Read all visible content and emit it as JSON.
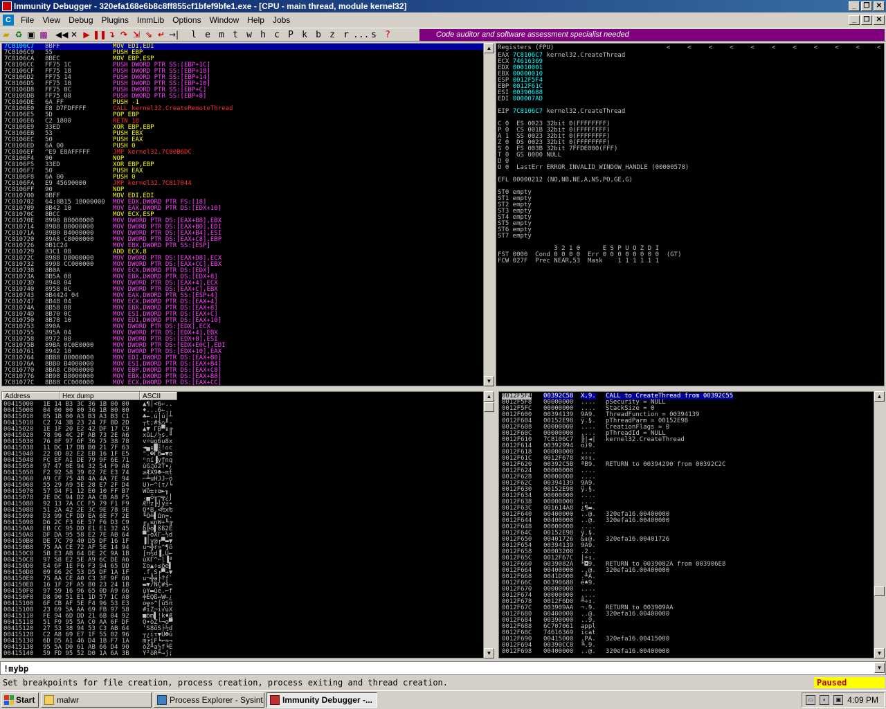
{
  "window": {
    "title": "Immunity Debugger - 320efa168e6b8c8ff855cf1bfef9bfe1.exe - [CPU - main thread, module kernel32]"
  },
  "menu": [
    "File",
    "View",
    "Debug",
    "Plugins",
    "ImmLib",
    "Options",
    "Window",
    "Help",
    "Jobs"
  ],
  "toolbar": {
    "letters": [
      "l",
      "e",
      "m",
      "t",
      "w",
      "h",
      "c",
      "P",
      "k",
      "b",
      "z",
      "r",
      "...",
      "s",
      "?"
    ],
    "banner": "Code auditor and software assessment specialist needed"
  },
  "disasm": [
    [
      "7C8106C7",
      "8BFF",
      "MOV EDI,EDI",
      "y"
    ],
    [
      "7C8106C9",
      "55",
      "PUSH EBP",
      "y"
    ],
    [
      "7C8106CA",
      "8BEC",
      "MOV EBP,ESP",
      "y"
    ],
    [
      "7C8106CC",
      "FF75 1C",
      "PUSH DWORD PTR SS:[EBP+1C]",
      "m"
    ],
    [
      "7C8106CF",
      "FF75 18",
      "PUSH DWORD PTR SS:[EBP+18]",
      "m"
    ],
    [
      "7C8106D2",
      "FF75 14",
      "PUSH DWORD PTR SS:[EBP+14]",
      "m"
    ],
    [
      "7C8106D5",
      "FF75 10",
      "PUSH DWORD PTR SS:[EBP+10]",
      "m"
    ],
    [
      "7C8106D8",
      "FF75 0C",
      "PUSH DWORD PTR SS:[EBP+C]",
      "m"
    ],
    [
      "7C8106DB",
      "FF75 08",
      "PUSH DWORD PTR SS:[EBP+8]",
      "m"
    ],
    [
      "7C8106DE",
      "6A FF",
      "PUSH -1",
      "y"
    ],
    [
      "7C8106E0",
      "E8 D7FDFFFF",
      "CALL kernel32.CreateRemoteThread",
      "r"
    ],
    [
      "7C8106E5",
      "5D",
      "POP EBP",
      "y"
    ],
    [
      "7C8106E6",
      "C2 1800",
      "RETN 18",
      "r"
    ],
    [
      "7C8106E9",
      "33ED",
      "XOR EBP,EBP",
      "y"
    ],
    [
      "7C8106EB",
      "53",
      "PUSH EBX",
      "y"
    ],
    [
      "7C8106EC",
      "50",
      "PUSH EAX",
      "y"
    ],
    [
      "7C8106ED",
      "6A 00",
      "PUSH 0",
      "y"
    ],
    [
      "7C8106EF",
      "^E9 E8AFFFFF",
      "JMP kernel32.7C80B6DC",
      "r"
    ],
    [
      "7C8106F4",
      "90",
      "NOP",
      "y"
    ],
    [
      "7C8106F5",
      "33ED",
      "XOR EBP,EBP",
      "y"
    ],
    [
      "7C8106F7",
      "50",
      "PUSH EAX",
      "y"
    ],
    [
      "7C8106F8",
      "6A 00",
      "PUSH 0",
      "y"
    ],
    [
      "7C8106FA",
      "E9 45690000",
      "JMP kernel32.7C817044",
      "r"
    ],
    [
      "7C8106FF",
      "90",
      "NOP",
      "y"
    ],
    [
      "7C810700",
      "8BFF",
      "MOV EDI,EDI",
      "y"
    ],
    [
      "7C810702",
      "64:8B15 18000000",
      "MOV EDX,DWORD PTR FS:[18]",
      "m"
    ],
    [
      "7C810709",
      "8B42 10",
      "MOV EAX,DWORD PTR DS:[EDX+10]",
      "m"
    ],
    [
      "7C81070C",
      "8BCC",
      "MOV ECX,ESP",
      "y"
    ],
    [
      "7C81070E",
      "8998 B8000000",
      "MOV DWORD PTR DS:[EAX+B8],EBX",
      "m"
    ],
    [
      "7C810714",
      "89B8 B0000000",
      "MOV DWORD PTR DS:[EAX+B0],EDI",
      "m"
    ],
    [
      "7C81071A",
      "89B0 B4000000",
      "MOV DWORD PTR DS:[EAX+B4],ESI",
      "m"
    ],
    [
      "7C810720",
      "89A8 C8000000",
      "MOV DWORD PTR DS:[EAX+C8],EBP",
      "m"
    ],
    [
      "7C810726",
      "8B1C24",
      "MOV EBX,DWORD PTR SS:[ESP]",
      "m"
    ],
    [
      "7C810729",
      "83C1 08",
      "ADD ECX,8",
      "y"
    ],
    [
      "7C81072C",
      "8988 D8000000",
      "MOV DWORD PTR DS:[EAX+D8],ECX",
      "m"
    ],
    [
      "7C810732",
      "8998 CC000000",
      "MOV DWORD PTR DS:[EAX+CC],EBX",
      "m"
    ],
    [
      "7C810738",
      "8B0A",
      "MOV ECX,DWORD PTR DS:[EDX]",
      "m"
    ],
    [
      "7C81073A",
      "8B5A 08",
      "MOV EBX,DWORD PTR DS:[EDX+8]",
      "m"
    ],
    [
      "7C81073D",
      "8948 04",
      "MOV DWORD PTR DS:[EAX+4],ECX",
      "m"
    ],
    [
      "7C810740",
      "8958 0C",
      "MOV DWORD PTR DS:[EAX+C],EBX",
      "m"
    ],
    [
      "7C810743",
      "8B4424 04",
      "MOV EAX,DWORD PTR SS:[ESP+4]",
      "m"
    ],
    [
      "7C810747",
      "8B48 04",
      "MOV ECX,DWORD PTR DS:[EAX+4]",
      "m"
    ],
    [
      "7C81074A",
      "8B58 08",
      "MOV EBX,DWORD PTR DS:[EAX+8]",
      "m"
    ],
    [
      "7C81074D",
      "8B70 0C",
      "MOV ESI,DWORD PTR DS:[EAX+C]",
      "m"
    ],
    [
      "7C810750",
      "8B78 10",
      "MOV EDI,DWORD PTR DS:[EAX+10]",
      "m"
    ],
    [
      "7C810753",
      "890A",
      "MOV DWORD PTR DS:[EDX],ECX",
      "m"
    ],
    [
      "7C810755",
      "895A 04",
      "MOV DWORD PTR DS:[EDX+4],EBX",
      "m"
    ],
    [
      "7C810758",
      "8972 08",
      "MOV DWORD PTR DS:[EDX+8],ESI",
      "m"
    ],
    [
      "7C81075B",
      "89BA 0C0E0000",
      "MOV DWORD PTR DS:[EDX+E0C],EDI",
      "m"
    ],
    [
      "7C810761",
      "8942 10",
      "MOV DWORD PTR DS:[EDX+10],EAX",
      "m"
    ],
    [
      "7C810764",
      "8BB8 B0000000",
      "MOV EDI,DWORD PTR DS:[EAX+B0]",
      "m"
    ],
    [
      "7C81076A",
      "8BB0 B4000000",
      "MOV ESI,DWORD PTR DS:[EAX+B4]",
      "m"
    ],
    [
      "7C810770",
      "8BA8 C8000000",
      "MOV EBP,DWORD PTR DS:[EAX+C8]",
      "m"
    ],
    [
      "7C810776",
      "8B98 B8000000",
      "MOV EBX,DWORD PTR DS:[EAX+B8]",
      "m"
    ],
    [
      "7C81077C",
      "8B88 CC000000",
      "MOV ECX,DWORD PTR DS:[EAX+CC]",
      "m"
    ]
  ],
  "registers": {
    "header": "Registers (FPU)",
    "lines": [
      [
        "EAX",
        "7C8106C7",
        "kernel32.CreateThread"
      ],
      [
        "ECX",
        "74616369",
        ""
      ],
      [
        "EDX",
        "00010001",
        ""
      ],
      [
        "EBX",
        "00000010",
        ""
      ],
      [
        "ESP",
        "0012F5F4",
        ""
      ],
      [
        "EBP",
        "0012F61C",
        ""
      ],
      [
        "ESI",
        "00390688",
        ""
      ],
      [
        "EDI",
        "000007AD",
        ""
      ]
    ],
    "eip": [
      "EIP",
      "7C8106C7",
      "kernel32.CreateThread"
    ],
    "flags": [
      "C 0  ES 0023 32bit 0(FFFFFFFF)",
      "P 0  CS 001B 32bit 0(FFFFFFFF)",
      "A 1  SS 0023 32bit 0(FFFFFFFF)",
      "Z 0  DS 0023 32bit 0(FFFFFFFF)",
      "S 0  FS 003B 32bit 7FFDE000(FFF)",
      "T 0  GS 0000 NULL",
      "D 0",
      "O 0  LastErr ERROR_INVALID_WINDOW_HANDLE (00000578)"
    ],
    "efl": "EFL 00000212 (NO,NB,NE,A,NS,PO,GE,G)",
    "fpu": [
      "ST0 empty",
      "ST1 empty",
      "ST2 empty",
      "ST3 empty",
      "ST4 empty",
      "ST5 empty",
      "ST6 empty",
      "ST7 empty"
    ],
    "fpu_tail": [
      "               3 2 1 0      E S P U O Z D I",
      "FST 0000  Cond 0 0 0 0  Err 0 0 0 0 0 0 0 0  (GT)",
      "FCW 027F  Prec NEAR,53  Mask    1 1 1 1 1 1"
    ]
  },
  "dump": {
    "headers": [
      "Address",
      "Hex dump",
      "ASCII"
    ],
    "rows": [
      [
        "00415000",
        "1E 14 B3 3C 36 1B 00 00",
        "▲¶│<6←.."
      ],
      [
        "00415008",
        "04 00 00 00 36 1B 00 00",
        "♦...6←.."
      ],
      [
        "00415010",
        "05 1B 00 A3 B3 A3 B3 C1",
        "♣←.ú│ú│┴"
      ],
      [
        "00415018",
        "C2 74 3B 23 24 7F BD 2D",
        "┬t;#$⌂╜-"
      ],
      [
        "00415020",
        "1E 1F 20 E2 42 DF 17 C9",
        "▲▼ ΓB▀↨╔"
      ],
      [
        "00415028",
        "78 96 4C 2F AB 73 2E A6",
        "xûL/½s.ª"
      ],
      [
        "00415030",
        "76 0F 97 6F 36 75 38 78",
        "v☼ùo6u8x"
      ],
      [
        "00415038",
        "11 DC 17 DB B0 21 7F 63",
        "◄▄↨█░!⌂c"
      ],
      [
        "00415040",
        "22 0D 02 E2 EB 16 1F E5",
        "\".☻Γδ▬▼σ"
      ],
      [
        "00415048",
        "FC EF A1 DE 79 9F 6E 71",
        "ⁿ∩í▐yƒnq"
      ],
      [
        "00415050",
        "97 47 0E 94 32 54 F9 A8",
        "ùG♫ö2T∙¿"
      ],
      [
        "00415058",
        "F2 92 58 39 02 7E E3 74",
        "≥ÆX9☻~πt"
      ],
      [
        "00415060",
        "A9 CF 75 48 4A 4A 7E 94",
        "⌐╧uHJJ~ö"
      ],
      [
        "00415068",
        "55 29 A9 5E 28 E7 2F D4",
        "U)⌐^(τ/╘"
      ],
      [
        "00415070",
        "57 94 F1 12 E0 10 FF B7",
        "Wö±↕α►╖"
      ],
      [
        "00415078",
        "2E DC 94 D2 AA CB A8 F5",
        ".▄ö╥¬╦¿⌡"
      ],
      [
        "00415080",
        "92 13 7A CC F5 79 F1 F9",
        "Æ‼z╠⌡y±∙"
      ],
      [
        "00415088",
        "51 2A 42 2E 3C 9E 78 9E",
        "Q*B.<₧x₧"
      ],
      [
        "00415090",
        "D3 99 CF DD EA 6E F7 2E",
        "╙Ö╧▌Ωn≈."
      ],
      [
        "00415098",
        "D6 2C F3 6E 57 F6 D3 C9",
        "╓,≤nW÷╙╔"
      ],
      [
        "004150A0",
        "EB CC 95 DD E1 E1 32 45",
        "δ╠ò▌ßß2E"
      ],
      [
        "004150A8",
        "DF DA 95 58 E2 7E AB 64",
        "▀┌òXΓ~½d"
      ],
      [
        "004150B0",
        "DE 7C 79 40 D5 DF 16 1F",
        "▐|y@╒▀▬▼"
      ],
      [
        "004150B8",
        "75 AA CE 72 AF 5E 14 94",
        "u¬╬r»^¶ö"
      ],
      [
        "004150C0",
        "5B E3 AB 64 DE 2C 9A 1B",
        "[π½d▐,Ü←"
      ],
      [
        "004150C8",
        "97 58 E2 5E A9 6C DE A6",
        "ùXΓ^⌐l▐ª"
      ],
      [
        "004150D0",
        "E4 6F 1E F6 F3 94 65 DD",
        "Σo▲÷≤öe▌"
      ],
      [
        "004150D8",
        "09 66 2C 53 D5 DF 1A 1F",
        ".f,S╒▀→▼"
      ],
      [
        "004150E0",
        "75 AA CE A0 C3 3F 9F 60",
        "u¬╬á├?ƒ`"
      ],
      [
        "004150E8",
        "16 1F 2F A5 80 23 24 1B",
        "▬▼/ÑÇ#$←"
      ],
      [
        "004150F0",
        "97 59 16 96 65 0D A9 66",
        "ùY▬ûe.⌐f"
      ],
      [
        "004150F8",
        "D8 90 51 E1 1D 57 1C A8",
        "╪ÉQß↔W∟¿"
      ],
      [
        "00415100",
        "6F CB AF 5E F4 96 53 E3",
        "o╦»^⌠ûSπ"
      ],
      [
        "00415108",
        "23 69 5A AA 69 FB 97 58",
        "#iZ¬i√ùX"
      ],
      [
        "00415110",
        "FE 94 6D DD 21 6B 04 92",
        "■öm▌!k♦Æ"
      ],
      [
        "00415118",
        "51 F9 95 5A C0 AA 6F DF",
        "Q∙òZ└¬o▀"
      ],
      [
        "00415120",
        "27 53 38 94 53 C3 AB 64",
        "'S8öS├½d"
      ],
      [
        "00415128",
        "C2 A8 69 E7 1F 55 02 96",
        "┬¿iτ▼U☻û"
      ],
      [
        "00415130",
        "6D D5 A1 46 D4 1B F7 1A",
        "m╒íF╘←≈→"
      ],
      [
        "00415138",
        "95 5A D0 61 AB 66 D4 90",
        "òZ╨a½f╘É"
      ],
      [
        "00415140",
        "59 FD 95 52 D0 1A 6A 3B",
        "Y²òR╨→j;"
      ]
    ]
  },
  "stack": [
    [
      "0012F5F4",
      "00392C58",
      "X,9.",
      "CALL to CreateThread from 00392C55",
      "sel"
    ],
    [
      "0012F5F8",
      "00000000",
      "....",
      "pSecurity = NULL",
      ""
    ],
    [
      "0012F5FC",
      "00000000",
      "....",
      "StackSize = 0",
      ""
    ],
    [
      "0012F600",
      "00394139",
      "9A9.",
      "ThreadFunction = 00394139",
      ""
    ],
    [
      "0012F604",
      "00152E98",
      "ÿ.§.",
      "pThreadParm = 00152E98",
      ""
    ],
    [
      "0012F608",
      "00000000",
      "....",
      "CreationFlags = 0",
      ""
    ],
    [
      "0012F60C",
      "00000000",
      "....",
      "pThreadId = NULL",
      ""
    ],
    [
      "0012F610",
      "7C8106C7",
      "╟|◄|",
      "kernel32.CreateThread",
      ""
    ],
    [
      "0012F614",
      "00392994",
      "ö)9.",
      "",
      ""
    ],
    [
      "0012F618",
      "00000000",
      "....",
      "",
      ""
    ],
    [
      "0012F61C",
      "0012F678",
      "x÷↕.",
      "",
      ""
    ],
    [
      "0012F620",
      "00392C5B",
      "ªB9.",
      "RETURN to 00394290 from 00392C2C",
      ""
    ],
    [
      "0012F624",
      "00000000",
      "....",
      "",
      ""
    ],
    [
      "0012F628",
      "00000000",
      "....",
      "",
      ""
    ],
    [
      "0012F62C",
      "00394139",
      "9A9.",
      "",
      ""
    ],
    [
      "0012F630",
      "00152E98",
      "ÿ.§.",
      "",
      ""
    ],
    [
      "0012F634",
      "00000000",
      "....",
      "",
      ""
    ],
    [
      "0012F638",
      "00000000",
      "....",
      "",
      ""
    ],
    [
      "0012F63C",
      "001614A8",
      "¿¶▬.",
      "",
      ""
    ],
    [
      "0012F640",
      "00400000",
      "..@.",
      "320efa16.00400000",
      ""
    ],
    [
      "0012F644",
      "00400000",
      "..@.",
      "320efa16.00400000",
      ""
    ],
    [
      "0012F648",
      "00000000",
      "....",
      "",
      ""
    ],
    [
      "0012F64C",
      "00152E98",
      "ÿ.§.",
      "",
      ""
    ],
    [
      "0012F650",
      "00401726",
      "&↨@.",
      "320efa16.00401726",
      ""
    ],
    [
      "0012F654",
      "00394139",
      "9A9.",
      "",
      ""
    ],
    [
      "0012F658",
      "00003200",
      ".2..",
      "",
      ""
    ],
    [
      "0012F65C",
      "0012F67C",
      "|÷↕.",
      "",
      ""
    ],
    [
      "0012F660",
      "0039082A",
      "*◘9.",
      "RETURN to 0039082A from 003906E8",
      ""
    ],
    [
      "0012F664",
      "00400000",
      "..@.",
      "320efa16.00400000",
      ""
    ],
    [
      "0012F668",
      "0041D000",
      ".╨A.",
      "",
      ""
    ],
    [
      "0012F66C",
      "00390688",
      "ê♠9.",
      "",
      ""
    ],
    [
      "0012F670",
      "00000000",
      "....",
      "",
      ""
    ],
    [
      "0012F674",
      "00000000",
      "....",
      "",
      ""
    ],
    [
      "0012F678",
      "0012F6D0",
      "╨÷↕.",
      "",
      ""
    ],
    [
      "0012F67C",
      "003909AA",
      "¬.9.",
      "RETURN to 003909AA",
      ""
    ],
    [
      "0012F680",
      "00400000",
      "..@.",
      "320efa16.00400000",
      ""
    ],
    [
      "0012F684",
      "00390000",
      "..9.",
      "",
      ""
    ],
    [
      "0012F688",
      "6C707061",
      "appl",
      "",
      ""
    ],
    [
      "0012F68C",
      "74616369",
      "icat",
      "",
      ""
    ],
    [
      "0012F690",
      "00415000",
      ".PA.",
      "320efa16.00415000",
      ""
    ],
    [
      "0012F694",
      "00390CC8",
      "╚.9.",
      "",
      ""
    ],
    [
      "0012F698",
      "00400000",
      "..@.",
      "320efa16.00400000",
      ""
    ]
  ],
  "command": {
    "value": "!mybp"
  },
  "status": {
    "message": "Set breakpoints for file creation, process creation, process exiting and thread creation.",
    "state": "Paused"
  },
  "taskbar": {
    "start": "Start",
    "tasks": [
      "malwr",
      "Process Explorer - Sysint...",
      "Immunity Debugger -..."
    ],
    "clock": "4:09 PM"
  },
  "colors": {
    "banner": "#800080",
    "selection": "#0000a0",
    "paused_bg": "#ffff00"
  }
}
